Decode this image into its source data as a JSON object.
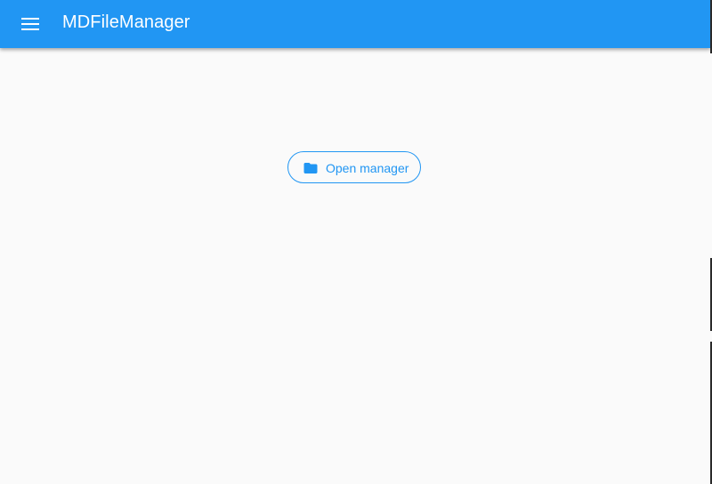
{
  "app_bar": {
    "title": "MDFileManager",
    "menu_icon": "menu-icon",
    "color": "#2196f3"
  },
  "main": {
    "open_button": {
      "label": "Open manager",
      "icon": "folder-icon",
      "color": "#2196f3"
    }
  },
  "colors": {
    "background": "#fafafa",
    "accent": "#2196f3"
  }
}
